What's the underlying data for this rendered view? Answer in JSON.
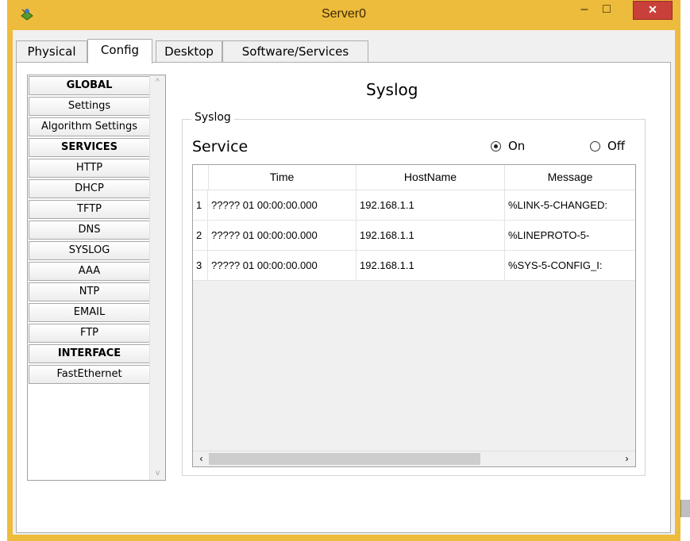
{
  "window": {
    "title": "Server0",
    "minimize_symbol": "–",
    "maximize_symbol": "□",
    "close_symbol": "✕",
    "frame_color": "#eebc3c",
    "close_color": "#c9403a"
  },
  "tabs": [
    {
      "label": "Physical",
      "active": false
    },
    {
      "label": "Config",
      "active": true
    },
    {
      "label": "Desktop",
      "active": false
    },
    {
      "label": "Software/Services",
      "active": false
    }
  ],
  "nav": {
    "items": [
      {
        "label": "GLOBAL",
        "header": true
      },
      {
        "label": "Settings",
        "header": false
      },
      {
        "label": "Algorithm Settings",
        "header": false
      },
      {
        "label": "SERVICES",
        "header": true
      },
      {
        "label": "HTTP",
        "header": false
      },
      {
        "label": "DHCP",
        "header": false
      },
      {
        "label": "TFTP",
        "header": false
      },
      {
        "label": "DNS",
        "header": false
      },
      {
        "label": "SYSLOG",
        "header": false
      },
      {
        "label": "AAA",
        "header": false
      },
      {
        "label": "NTP",
        "header": false
      },
      {
        "label": "EMAIL",
        "header": false
      },
      {
        "label": "FTP",
        "header": false
      },
      {
        "label": "INTERFACE",
        "header": true
      },
      {
        "label": "FastEthernet",
        "header": false
      }
    ]
  },
  "syslog": {
    "title": "Syslog",
    "group_label": "Syslog",
    "service_label": "Service",
    "on_label": "On",
    "off_label": "Off",
    "service_on": true
  },
  "table": {
    "columns": [
      "Time",
      "HostName",
      "Message"
    ],
    "rows": [
      {
        "num": "1",
        "time": "????? 01 00:00:00.000",
        "host": "192.168.1.1",
        "message": "%LINK-5-CHANGED:"
      },
      {
        "num": "2",
        "time": "????? 01 00:00:00.000",
        "host": "192.168.1.1",
        "message": "%LINEPROTO-5-"
      },
      {
        "num": "3",
        "time": "????? 01 00:00:00.000",
        "host": "192.168.1.1",
        "message": "%SYS-5-CONFIG_I:"
      }
    ]
  },
  "icons": {
    "app": "packet-tracer-server-icon",
    "scroll_left": "‹",
    "scroll_right": "›",
    "scroll_up": "^",
    "scroll_down": "v"
  }
}
